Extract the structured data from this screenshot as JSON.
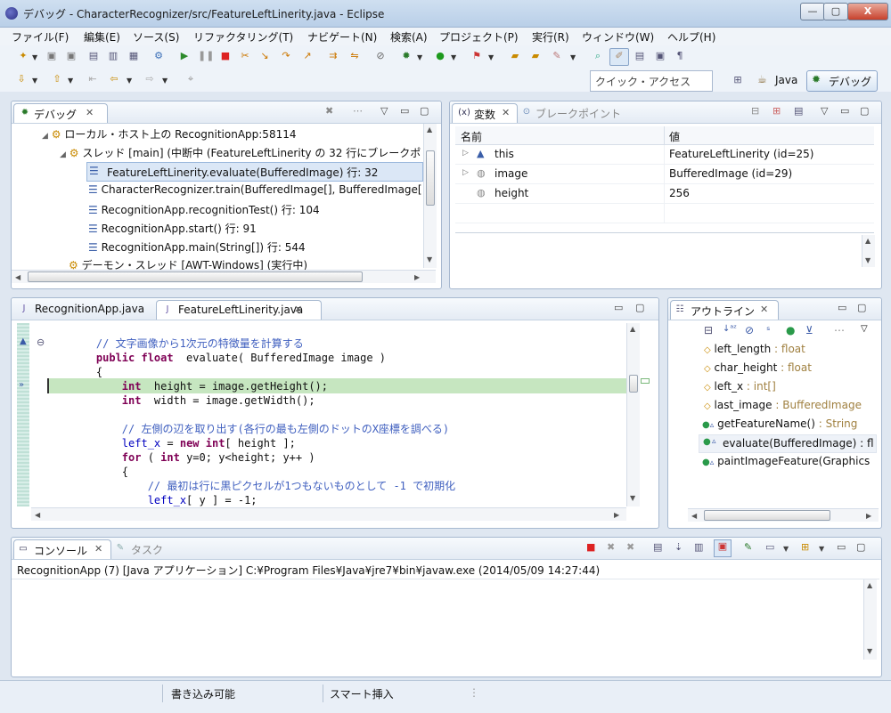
{
  "window": {
    "title": "デバッグ - CharacterRecognizer/src/FeatureLeftLinerity.java - Eclipse",
    "minimize": "—",
    "maximize": "▢",
    "close": "X"
  },
  "menu": [
    "ファイル(F)",
    "編集(E)",
    "ソース(S)",
    "リファクタリング(T)",
    "ナビゲート(N)",
    "検索(A)",
    "プロジェクト(P)",
    "実行(R)",
    "ウィンドウ(W)",
    "ヘルプ(H)"
  ],
  "toolbar": {
    "quick_access_placeholder": "クイック・アクセス",
    "perspective_java": "Java",
    "perspective_debug": "デバッグ"
  },
  "debug_view": {
    "tab": "デバッグ",
    "items": [
      "ローカル・ホスト上の RecognitionApp:58114",
      "スレッド [main] (中断中 (FeatureLeftLinerity の 32 行にブレークポ",
      "FeatureLeftLinerity.evaluate(BufferedImage) 行: 32",
      "CharacterRecognizer.train(BufferedImage[], BufferedImage[",
      "RecognitionApp.recognitionTest() 行: 104",
      "RecognitionApp.start() 行: 91",
      "RecognitionApp.main(String[]) 行: 544",
      "デーモン・スレッド [AWT-Windows] (実行中)"
    ]
  },
  "variables_view": {
    "tab": "変数",
    "tab2": "ブレークポイント",
    "col_name": "名前",
    "col_value": "値",
    "rows": [
      {
        "name": "this",
        "value": "FeatureLeftLinerity  (id=25)"
      },
      {
        "name": "image",
        "value": "BufferedImage  (id=29)"
      },
      {
        "name": "height",
        "value": "256"
      }
    ]
  },
  "editor": {
    "tab1": "RecognitionApp.java",
    "tab2": "FeatureLeftLinerity.java",
    "lines": [
      {
        "c": "    // 文字画像から1次元の特徴量を計算する"
      },
      {
        "k": "    public float",
        "t": "  evaluate( BufferedImage image )"
      },
      {
        "t": "    {"
      },
      {
        "k": "        int",
        "t": "  height = image.getHeight();"
      },
      {
        "k": "        int",
        "t": "  width = image.getWidth();"
      },
      {
        "t": ""
      },
      {
        "c": "        // 左側の辺を取り出す(各行の最も左側のドットのX座標を調べる)"
      },
      {
        "f": "        left_x",
        "t": " = ",
        "k": "new int",
        "t2": "[ height ];"
      },
      {
        "k": "        for",
        "t": " ( ",
        "k2": "int",
        "t2": " y=0; y<height; y++ )"
      },
      {
        "t": "        {"
      },
      {
        "c": "            // 最初は行に黒ピクセルが1つもないものとして -1 で初期化"
      },
      {
        "f": "            left_x",
        "t": "[ y ] = -1;"
      }
    ]
  },
  "outline_view": {
    "tab": "アウトライン",
    "items": [
      {
        "name": "left_length",
        "type": " : float"
      },
      {
        "name": "char_height",
        "type": " : float"
      },
      {
        "name": "left_x",
        "type": " : int[]"
      },
      {
        "name": "last_image",
        "type": " : BufferedImage"
      },
      {
        "name": "getFeatureName()",
        "type": " : String"
      },
      {
        "name": "evaluate(BufferedImage)",
        "type": " : fl"
      },
      {
        "name": "paintImageFeature(Graphics",
        "type": ""
      }
    ]
  },
  "console_view": {
    "tab": "コンソール",
    "tab2": "タスク",
    "text": "RecognitionApp (7) [Java アプリケーション] C:¥Program Files¥Java¥jre7¥bin¥javaw.exe (2014/05/09 14:27:44)"
  },
  "statusbar": {
    "writable": "書き込み可能",
    "insert_mode": "スマート挿入"
  }
}
